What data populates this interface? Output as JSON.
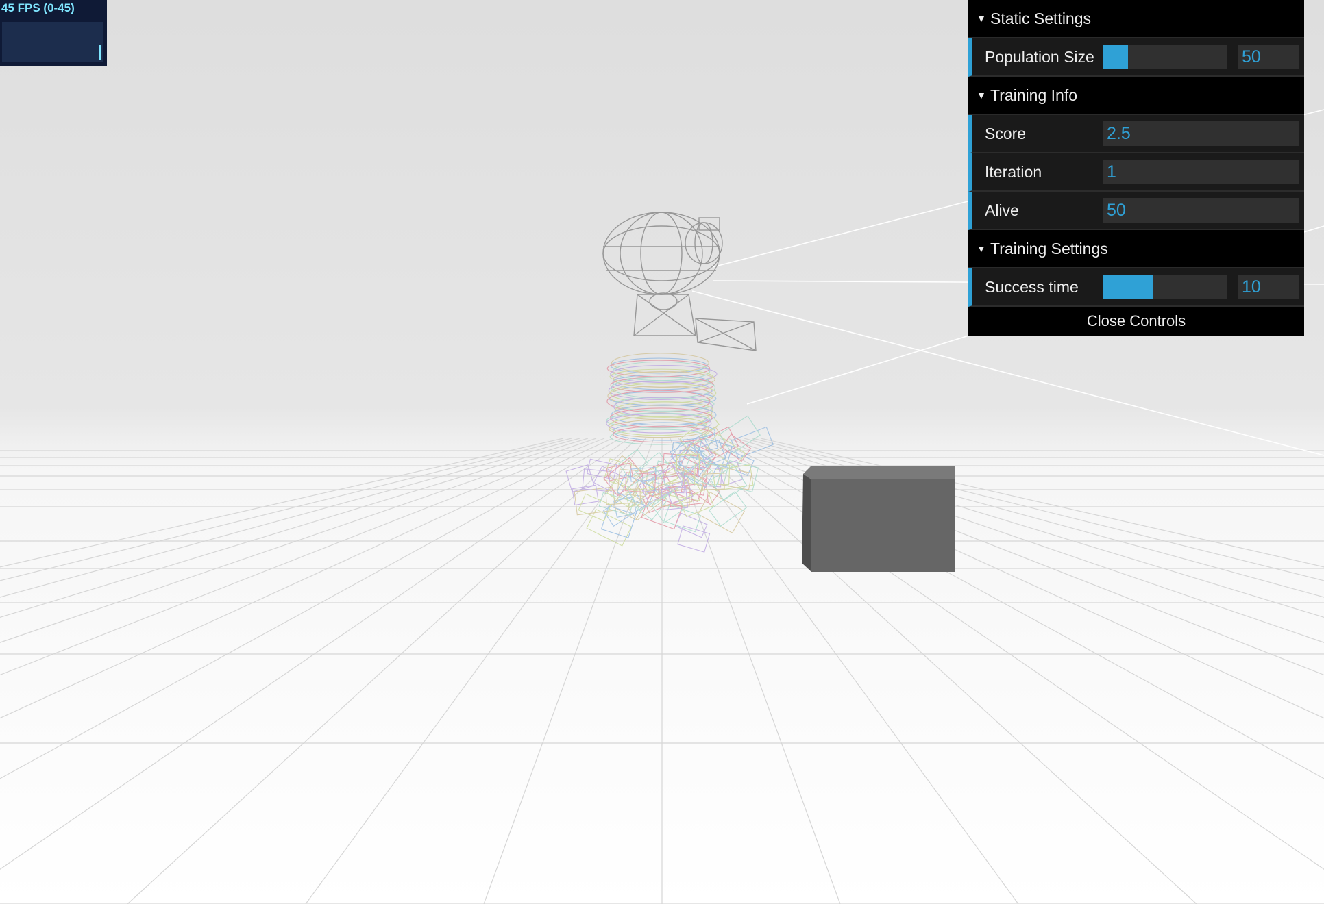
{
  "fps": {
    "label": "45 FPS (0-45)"
  },
  "gui": {
    "folders": [
      {
        "title": "Static Settings",
        "controls": [
          {
            "name": "Population Size",
            "value": "50",
            "slider_fraction": 0.2
          }
        ]
      },
      {
        "title": "Training Info",
        "controls": [
          {
            "name": "Score",
            "value": "2.5"
          },
          {
            "name": "Iteration",
            "value": "1"
          },
          {
            "name": "Alive",
            "value": "50"
          }
        ]
      },
      {
        "title": "Training Settings",
        "controls": [
          {
            "name": "Success time",
            "value": "10",
            "slider_fraction": 0.4
          }
        ]
      }
    ],
    "close_label": "Close Controls"
  },
  "scene": {
    "background_color": "#e2e2e2",
    "floor_color": "#ffffff",
    "grid_color": "#d4d4d4",
    "robot_color": "#8f8f8f",
    "box_color": "#666666"
  }
}
